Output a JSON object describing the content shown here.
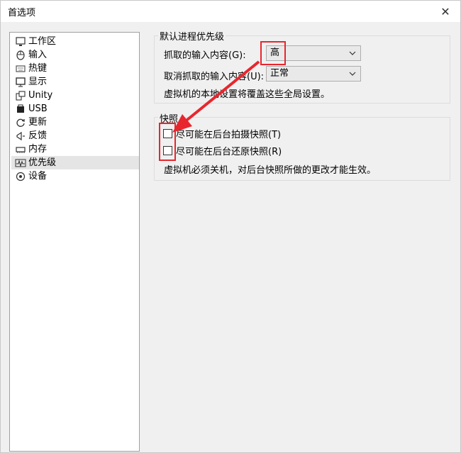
{
  "window": {
    "title": "首选项",
    "close_symbol": "✕"
  },
  "sidebar": {
    "items": [
      {
        "label": "工作区",
        "icon": "workspace-icon"
      },
      {
        "label": "输入",
        "icon": "mouse-icon"
      },
      {
        "label": "热键",
        "icon": "keyboard-icon"
      },
      {
        "label": "显示",
        "icon": "monitor-icon"
      },
      {
        "label": "Unity",
        "icon": "unity-icon"
      },
      {
        "label": "USB",
        "icon": "usb-icon"
      },
      {
        "label": "更新",
        "icon": "refresh-icon"
      },
      {
        "label": "反馈",
        "icon": "megaphone-icon"
      },
      {
        "label": "内存",
        "icon": "memory-icon"
      },
      {
        "label": "优先级",
        "icon": "pulse-icon",
        "selected": true
      },
      {
        "label": "设备",
        "icon": "device-icon"
      }
    ]
  },
  "priority_group": {
    "title": "默认进程优先级",
    "grab_label": "抓取的输入内容(G):",
    "grab_value": "高",
    "ungrab_label": "取消抓取的输入内容(U):",
    "ungrab_value": "正常",
    "note": "虚拟机的本地设置将覆盖这些全局设置。"
  },
  "snapshot_group": {
    "title": "快照",
    "take_label": "尽可能在后台拍摄快照(T)",
    "restore_label": "尽可能在后台还原快照(R)",
    "note": "虚拟机必须关机，对后台快照所做的更改才能生效。"
  },
  "colors": {
    "highlight": "#e8262d",
    "selected_bg": "#e5e5e5"
  }
}
